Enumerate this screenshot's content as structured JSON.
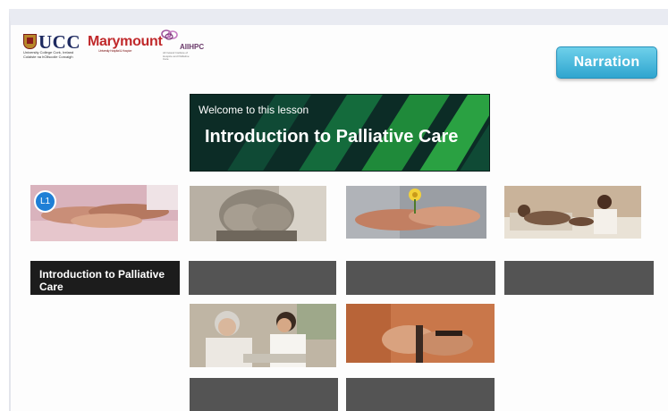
{
  "logos": {
    "ucc": {
      "name": "UCC",
      "subtitle": "University College Cork, Ireland Coláiste na hOllscoile Corcaigh"
    },
    "marymount": {
      "name": "Marymount",
      "subtitle": "University Hospital & Hospice"
    },
    "aiihpc": {
      "name": "AIIHPC",
      "subtitle": "All Ireland Institute of Hospice and Palliative Care"
    }
  },
  "header": {
    "narration_label": "Narration"
  },
  "banner": {
    "welcome": "Welcome to this lesson",
    "title": "Introduction to Palliative Care"
  },
  "lessons": [
    {
      "badge": "L1",
      "label": "Introduction to Palliative Care",
      "image": "hands-holding-photo",
      "active": true
    },
    {
      "badge": "",
      "label": "",
      "image": "elderly-hands-face-photo",
      "active": false
    },
    {
      "badge": "",
      "label": "",
      "image": "hands-flower-photo",
      "active": false
    },
    {
      "badge": "",
      "label": "",
      "image": "nurse-patient-bed-photo",
      "active": false
    },
    {
      "badge": "",
      "label": "",
      "image": "nurse-elderly-woman-photo",
      "active": false
    },
    {
      "badge": "",
      "label": "",
      "image": "elderly-hands-cane-photo",
      "active": false
    }
  ],
  "colors": {
    "narration_button": "#2fa5cf",
    "banner_bg": "#0d2f28",
    "banner_stripe": "#1f8a3a",
    "active_label_bg": "#1c1c1c",
    "inactive_label_bg": "#545454",
    "badge": "#1f7fd6"
  }
}
